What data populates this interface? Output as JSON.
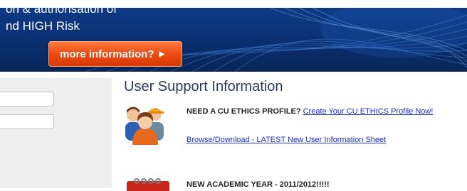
{
  "banner": {
    "line1": "on & authorisation of",
    "line2": "nd HIGH Risk",
    "button_label": "more information?"
  },
  "main": {
    "heading": "User Support Information",
    "items": [
      {
        "bold_text": "NEED A CU ETHICS PROFILE?",
        "link_text": "Create Your CU ETHICS Profile Now!"
      },
      {
        "link_text": "Browse/Download - LATEST New User Information Sheet"
      },
      {
        "bold_text": "NEW ACADEMIC YEAR - 2011/2012!!!!!"
      }
    ]
  },
  "colors": {
    "banner_bg": "#0a2f70",
    "button_bg": "#ee4b12",
    "heading": "#2a3a5e",
    "link": "#1a2fd0"
  }
}
